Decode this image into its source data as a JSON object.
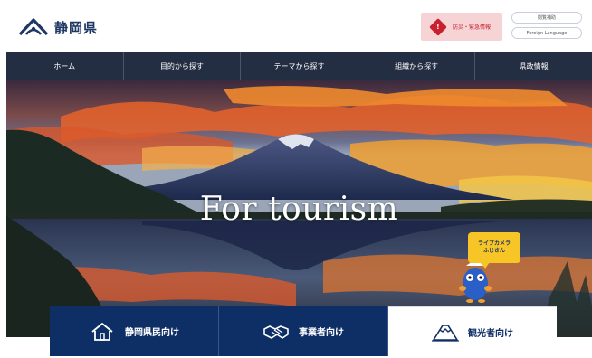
{
  "header": {
    "site_name": "静岡県",
    "disaster_button": {
      "icon_glyph": "!",
      "label": "防災・緊急情報"
    },
    "utility_links": [
      {
        "label": "閲覧補助"
      },
      {
        "label": "Foreign Language"
      }
    ]
  },
  "nav": {
    "items": [
      {
        "label": "ホーム"
      },
      {
        "label": "目的から探す"
      },
      {
        "label": "テーマから探す"
      },
      {
        "label": "組織から探す"
      },
      {
        "label": "県政情報"
      }
    ]
  },
  "hero": {
    "headline": "For tourism",
    "mascot_bubble": {
      "line1": "ライブカメラ",
      "line2": "ふじさん"
    }
  },
  "audience_tabs": [
    {
      "label": "静岡県民向け",
      "icon": "house-icon",
      "active": false
    },
    {
      "label": "事業者向け",
      "icon": "handshake-icon",
      "active": false
    },
    {
      "label": "観光者向け",
      "icon": "mountain-icon",
      "active": true
    }
  ],
  "colors": {
    "brand_navy": "#1e3763",
    "nav_bg": "#242e42",
    "tab_navy": "#0e2e66",
    "alert_red": "#c8202f",
    "alert_bg": "#f6d3d5",
    "mascot_yellow": "#f7c526"
  }
}
